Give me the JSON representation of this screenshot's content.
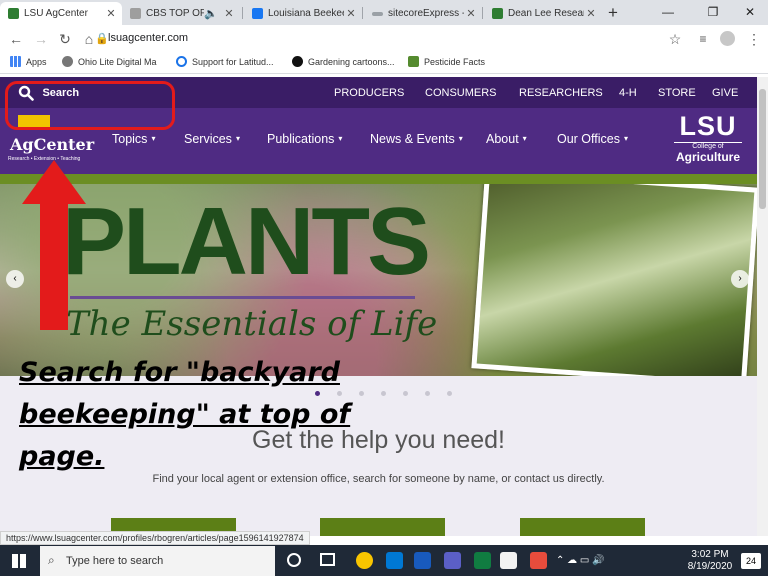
{
  "browser": {
    "tabs": [
      {
        "title": "LSU AgCenter",
        "active": true,
        "fav": "#2e7d32"
      },
      {
        "title": "CBS TOP OF T",
        "active": false,
        "fav": "#9e9e9e"
      },
      {
        "title": "Louisiana Beekee",
        "active": false,
        "fav": "#1877f2"
      },
      {
        "title": "sitecoreExpress -",
        "active": false,
        "fav": "#9aa0a6"
      },
      {
        "title": "Dean Lee Researc",
        "active": false,
        "fav": "#2e7d32"
      }
    ],
    "url": "lsuagcenter.com",
    "bookmarks": [
      "Apps",
      "Ohio Lite Digital Ma",
      "Support for Latitud...",
      "Gardening cartoons...",
      "Pesticide Facts"
    ]
  },
  "site": {
    "search_label": "Search",
    "top_links": [
      "PRODUCERS",
      "CONSUMERS",
      "RESEARCHERS",
      "4-H",
      "STORE",
      "GIVE"
    ],
    "logo": {
      "text": "AgCenter",
      "sub": "Research • Extension • Teaching"
    },
    "nav": [
      "Topics",
      "Services",
      "Publications",
      "News & Events",
      "About",
      "Our Offices"
    ],
    "lsu_logo": {
      "big": "LSU",
      "line1": "College of",
      "line2": "Agriculture"
    },
    "hero": {
      "title": "PLANTS",
      "subtitle": "The Essentials of Life",
      "active_slide": 1,
      "slide_count": 7
    },
    "help": {
      "heading": "Get the help you need!",
      "text": "Find your local agent or extension office, search for someone by name, or contact us directly."
    }
  },
  "annotation": {
    "text": "Search for \"backyard beekeeping\" at top of page.",
    "color": "#e31b1b"
  },
  "status_url": "https://www.lsuagcenter.com/profiles/rbogren/articles/page1596141927874",
  "taskbar": {
    "search_placeholder": "Type here to search",
    "time": "3:02 PM",
    "date": "8/19/2020",
    "notification_count": "24"
  },
  "colors": {
    "purple_dark": "#3a1d66",
    "purple": "#4f2b83",
    "green": "#6b8e23",
    "gold": "#f2c400"
  }
}
